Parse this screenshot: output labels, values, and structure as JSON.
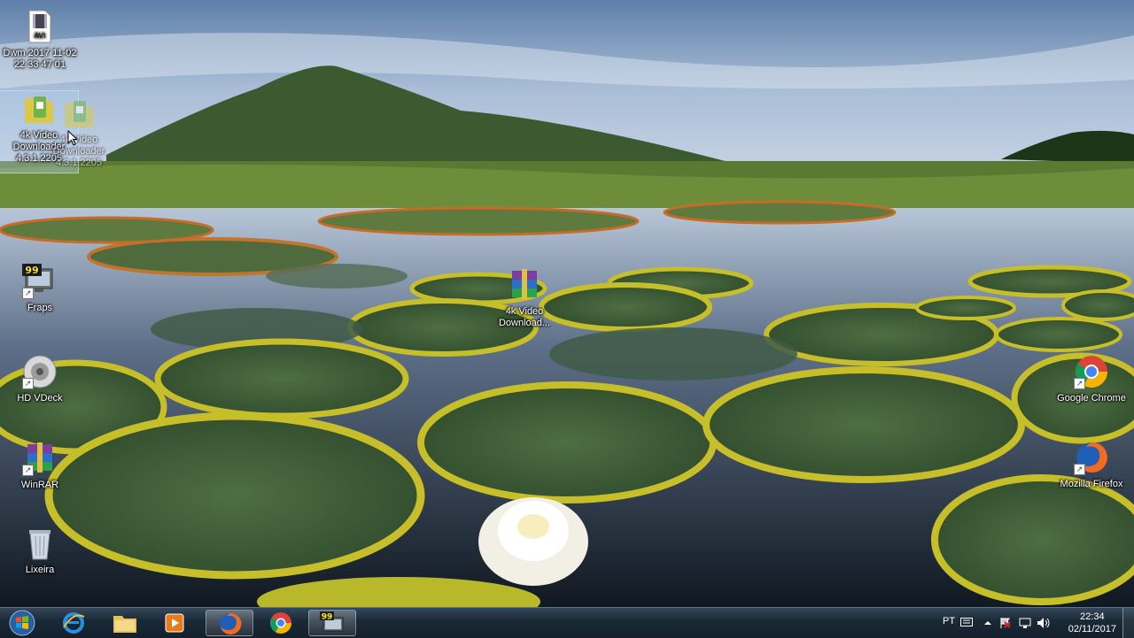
{
  "desktop": {
    "icons": {
      "dwm_video": {
        "label": "Dwm 2017 11-02 22 33 47 01",
        "badge": "AVI"
      },
      "video_downloader": {
        "label": "4k Video Downloader 4.3.1.2205"
      },
      "video_downloader_drag": {
        "label": "4k Video Downloader 4.3.1.2205"
      },
      "fraps": {
        "label": "Fraps",
        "badge": "99"
      },
      "winrar_archive": {
        "label": "4k Video Download..."
      },
      "hd_vdeck": {
        "label": "HD VDeck"
      },
      "winrar": {
        "label": "WinRAR"
      },
      "recycle_bin": {
        "label": "Lixeira"
      },
      "chrome": {
        "label": "Google Chrome"
      },
      "firefox": {
        "label": "Mozilla Firefox"
      }
    }
  },
  "taskbar": {
    "buttons": [
      {
        "name": "start",
        "icon": "windows-logo-icon"
      },
      {
        "name": "internet-explorer",
        "icon": "ie-icon"
      },
      {
        "name": "file-explorer",
        "icon": "folder-icon"
      },
      {
        "name": "media-player",
        "icon": "media-player-icon"
      },
      {
        "name": "firefox",
        "icon": "firefox-icon",
        "active": true
      },
      {
        "name": "chrome",
        "icon": "chrome-icon"
      },
      {
        "name": "fraps",
        "icon": "fraps-icon",
        "active": true,
        "badge": "99"
      }
    ],
    "tray": {
      "language": "PT",
      "time": "22:34",
      "date": "02/11/2017"
    }
  },
  "colors": {
    "taskbar": "#1b2a38",
    "selection": "#b4d2f0",
    "sky": "#8fa8c8"
  }
}
